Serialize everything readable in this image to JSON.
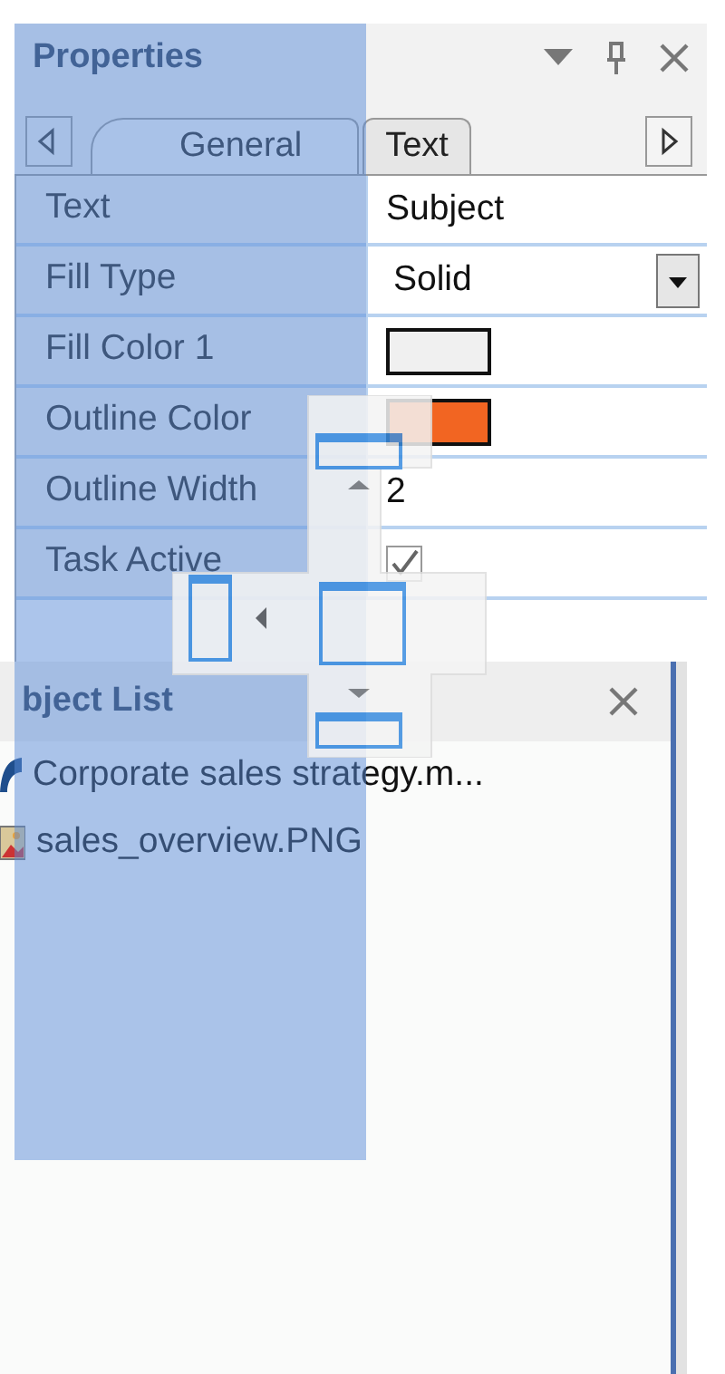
{
  "properties": {
    "title": "Properties",
    "tabs": [
      {
        "label": "General",
        "selected": true
      },
      {
        "label": "Text",
        "selected": false
      }
    ],
    "rows": [
      {
        "kind": "text",
        "label": "Text",
        "value": "Subject"
      },
      {
        "kind": "dropdown",
        "label": "Fill Type",
        "value": "Solid"
      },
      {
        "kind": "color",
        "label": "Fill Color 1",
        "color": "#f0f0f0"
      },
      {
        "kind": "color",
        "label": "Outline Color",
        "color": "#f26522"
      },
      {
        "kind": "text",
        "label": "Outline Width",
        "value": "2"
      },
      {
        "kind": "checkbox",
        "label": "Task Active",
        "checked": true
      }
    ]
  },
  "object_list": {
    "title": "bject List",
    "items": [
      {
        "kind": "document",
        "label": "Corporate sales strategy.m..."
      },
      {
        "kind": "image",
        "label": "sales_overview.PNG"
      }
    ]
  }
}
